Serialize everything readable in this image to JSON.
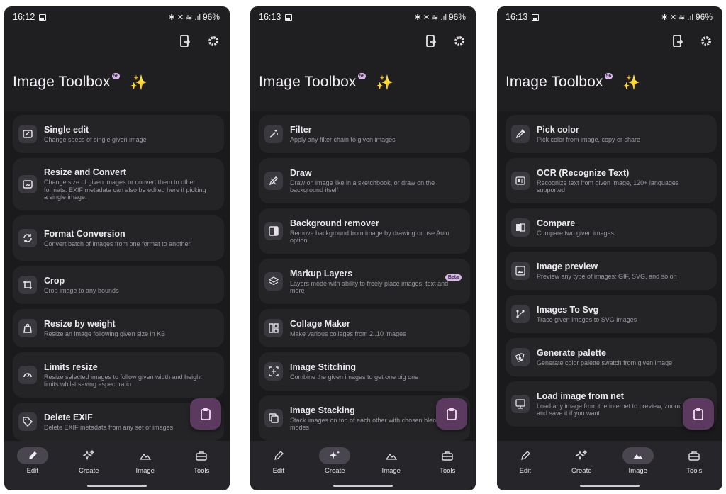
{
  "shared": {
    "app_title": "Image Toolbox",
    "title_badge": "56",
    "sparkle": "✨",
    "battery": "96%",
    "status_symbols": "✱ ✕ ≋ .ıl",
    "nav": [
      "Edit",
      "Create",
      "Image",
      "Tools"
    ]
  },
  "screens": [
    {
      "time": "16:12",
      "active_tab": "Edit",
      "items": [
        {
          "title": "Single edit",
          "desc": "Change specs of single given image",
          "icon": "single-edit-icon"
        },
        {
          "title": "Resize and Convert",
          "desc": "Change size of given images or convert them to other formats. EXIF metadata can also be edited here if picking a single image.",
          "icon": "resize-convert-icon"
        },
        {
          "title": "Format Conversion",
          "desc": "Convert batch of images from one format to another",
          "icon": "format-conversion-icon"
        },
        {
          "title": "Crop",
          "desc": "Crop image to any bounds",
          "icon": "crop-icon"
        },
        {
          "title": "Resize by weight",
          "desc": "Resize an image following given size in KB",
          "icon": "weight-icon"
        },
        {
          "title": "Limits resize",
          "desc": "Resize selected images to follow given width and height limits whilst saving aspect ratio",
          "icon": "limits-icon"
        },
        {
          "title": "Delete EXIF",
          "desc": "Delete EXIF metadata from any set of images",
          "icon": "tag-icon"
        }
      ]
    },
    {
      "time": "16:13",
      "active_tab": "Create",
      "items": [
        {
          "title": "Filter",
          "desc": "Apply any filter chain to given images",
          "icon": "magic-wand-icon"
        },
        {
          "title": "Draw",
          "desc": "Draw on image like in a sketchbook, or draw on the background itself",
          "icon": "draw-icon"
        },
        {
          "title": "Background remover",
          "desc": "Remove background from image by drawing or use Auto option",
          "icon": "background-remover-icon"
        },
        {
          "title": "Markup Layers",
          "desc": "Layers mode with ability to freely place images, text and more",
          "icon": "layers-icon",
          "badge": "Beta"
        },
        {
          "title": "Collage Maker",
          "desc": "Make various collages from 2..10 images",
          "icon": "collage-icon"
        },
        {
          "title": "Image Stitching",
          "desc": "Combine the given images to get one big one",
          "icon": "stitching-icon"
        },
        {
          "title": "Image Stacking",
          "desc": "Stack images on top of each other with chosen blend modes",
          "icon": "stacking-icon"
        }
      ]
    },
    {
      "time": "16:13",
      "active_tab": "Image",
      "items": [
        {
          "title": "Pick color",
          "desc": "Pick color from image, copy or share",
          "icon": "eyedropper-icon"
        },
        {
          "title": "OCR (Recognize Text)",
          "desc": "Recognize text from given image, 120+ languages supported",
          "icon": "ocr-icon"
        },
        {
          "title": "Compare",
          "desc": "Compare two given images",
          "icon": "compare-icon"
        },
        {
          "title": "Image preview",
          "desc": "Preview any type of images: GIF, SVG, and so on",
          "icon": "image-preview-icon"
        },
        {
          "title": "Images To Svg",
          "desc": "Trace given images to SVG images",
          "icon": "svg-trace-icon"
        },
        {
          "title": "Generate palette",
          "desc": "Generate color palette swatch from given image",
          "icon": "palette-icon"
        },
        {
          "title": "Load image from net",
          "desc": "Load any image from the internet to preview, zoom, edit and save it if you want.",
          "icon": "web-image-icon"
        }
      ]
    }
  ]
}
